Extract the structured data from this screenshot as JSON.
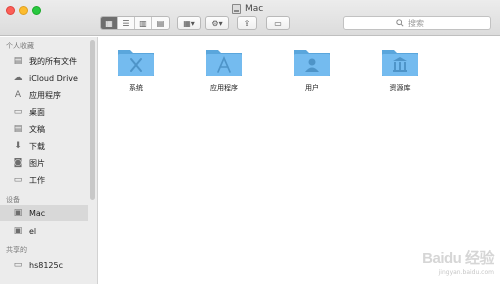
{
  "window": {
    "title": "Mac"
  },
  "toolbar": {
    "view_modes": [
      "▦",
      "☰",
      "▥",
      "▤"
    ],
    "group_by": "▦▾",
    "action": "⚙▾",
    "share": "⇪",
    "tag": "▭",
    "search_placeholder": "搜索",
    "search_icon": "search-icon"
  },
  "sidebar": {
    "favorites_label": "个人收藏",
    "favorites": [
      {
        "label": "我的所有文件",
        "icon": "all-files-icon"
      },
      {
        "label": "iCloud Drive",
        "icon": "cloud-icon"
      },
      {
        "label": "应用程序",
        "icon": "applications-icon"
      },
      {
        "label": "桌面",
        "icon": "desktop-icon"
      },
      {
        "label": "文稿",
        "icon": "documents-icon"
      },
      {
        "label": "下载",
        "icon": "download-icon"
      },
      {
        "label": "图片",
        "icon": "pictures-icon"
      },
      {
        "label": "工作",
        "icon": "folder-icon"
      }
    ],
    "devices_label": "设备",
    "devices": [
      {
        "label": "Mac",
        "icon": "disk-icon",
        "selected": true
      },
      {
        "label": "el",
        "icon": "disk-icon"
      }
    ],
    "shared_label": "共享的",
    "shared": [
      {
        "label": "hs8125c",
        "icon": "display-icon"
      }
    ]
  },
  "folders": [
    {
      "label": "系统",
      "icon": "system-folder-icon"
    },
    {
      "label": "应用程序",
      "icon": "applications-folder-icon"
    },
    {
      "label": "用户",
      "icon": "users-folder-icon"
    },
    {
      "label": "资源库",
      "icon": "library-folder-icon"
    }
  ],
  "watermark": {
    "logo": "Baidu 经验",
    "site": "jingyan.baidu.com"
  },
  "colors": {
    "folder": "#6fb8ec",
    "folder_dark": "#5aa6dc",
    "selection": "#d8d8d8"
  }
}
